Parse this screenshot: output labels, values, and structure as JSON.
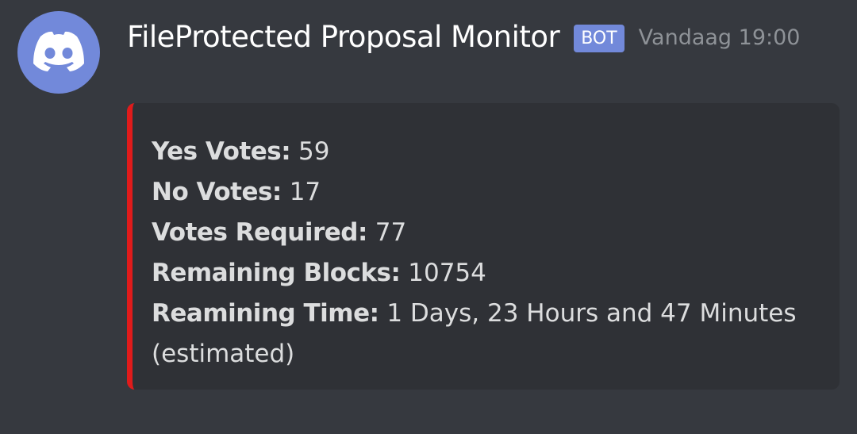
{
  "author": {
    "name": "FileProtected Proposal Monitor",
    "tag": "BOT",
    "timestamp": "Vandaag 19:00",
    "avatar_icon": "discord-logo-icon",
    "avatar_color": "#7289da"
  },
  "embed": {
    "accent_color": "#e01b1b",
    "fields": [
      {
        "name": "Yes Votes:",
        "value": "59"
      },
      {
        "name": "No Votes:",
        "value": "17"
      },
      {
        "name": "Votes Required:",
        "value": "77"
      },
      {
        "name": "Remaining Blocks:",
        "value": "10754"
      },
      {
        "name": "Reamining Time:",
        "value": "1 Days, 23 Hours and 47 Minutes"
      }
    ],
    "note": "(estimated)"
  }
}
